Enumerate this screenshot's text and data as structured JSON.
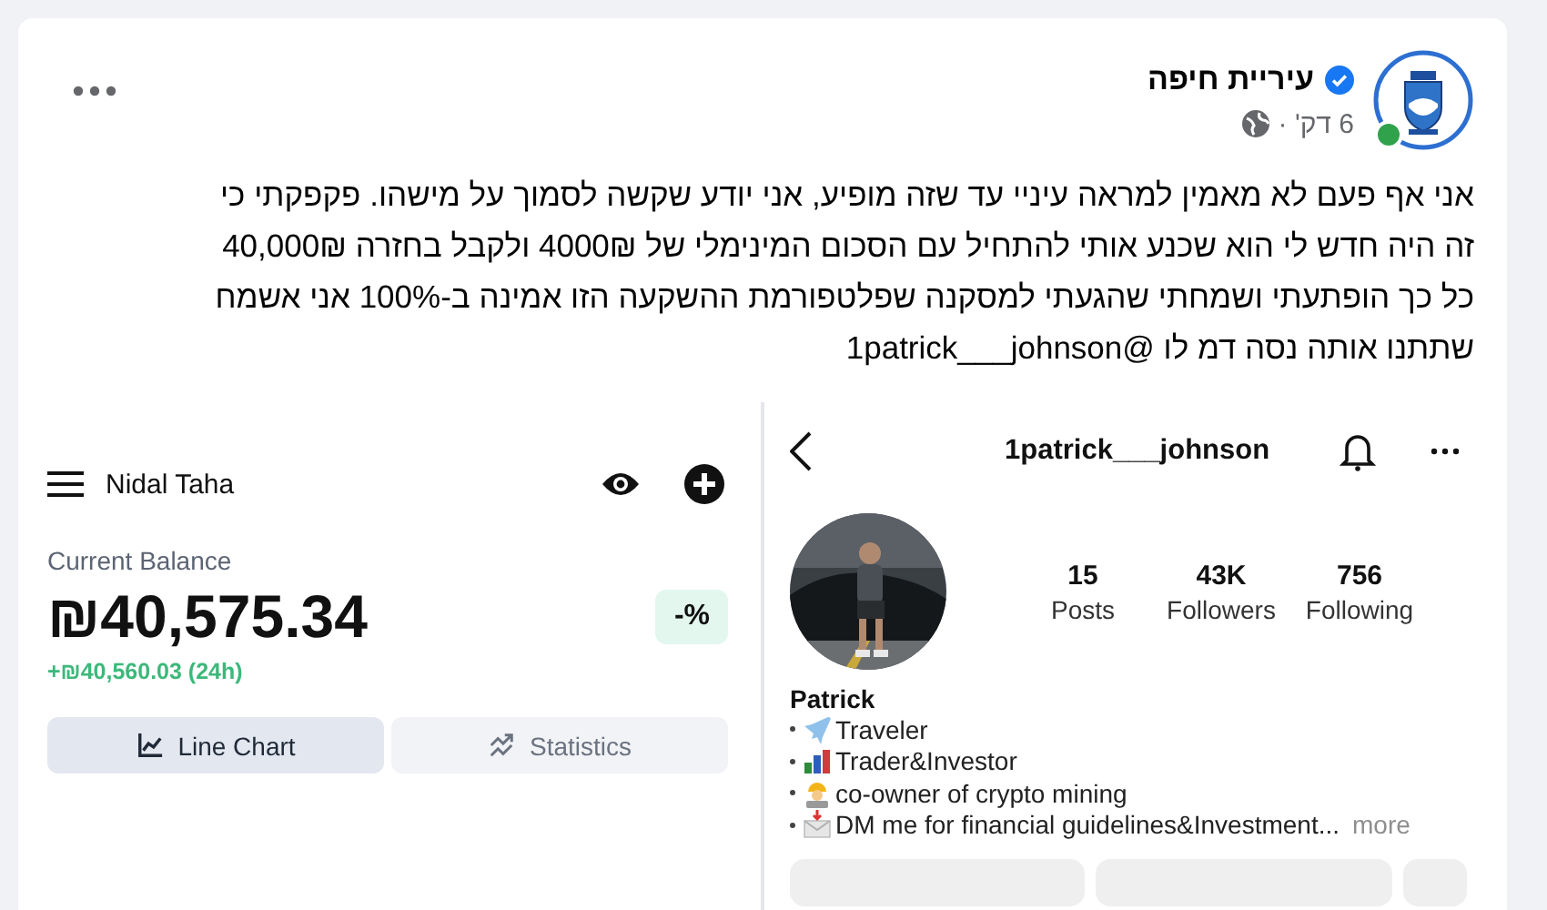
{
  "post": {
    "author": "עיריית חיפה",
    "verified": true,
    "online": true,
    "time": "6 דק' ·",
    "lines": [
      "אני אף פעם לא מאמין למראה עיניי עד שזה מופיע, אני יודע שקשה לסמוך על מישהו.  פקפקתי כי",
      "זה היה חדש לי הוא שכנע אותי להתחיל עם הסכום המינימלי של 4000₪ ולקבל בחזרה 40,000₪",
      "כל כך הופתעתי ושמחתי שהגעתי למסקנה שפלטפורמת ההשקעה הזו אמינה ב-100% אני אשמח",
      "שתתנו אותה  נסה דמ לו @1patrick___johnson"
    ]
  },
  "wallet": {
    "user": "Nidal Taha",
    "balance_label": "Current Balance",
    "balance": "₪40,575.34",
    "change_badge": "-%",
    "change": "+₪40,560.03 (24h)",
    "tabs": [
      {
        "label": "Line Chart",
        "selected": true
      },
      {
        "label": "Statistics",
        "selected": false
      }
    ]
  },
  "profile": {
    "username": "1patrick___johnson",
    "stats": [
      {
        "value": "15",
        "label": "Posts"
      },
      {
        "value": "43K",
        "label": "Followers"
      },
      {
        "value": "756",
        "label": "Following"
      }
    ],
    "name": "Patrick",
    "bio": [
      {
        "kind": "plane",
        "text": "Traveler"
      },
      {
        "kind": "chart",
        "text": "Trader&Investor"
      },
      {
        "kind": "worker",
        "text": "co-owner of crypto mining"
      },
      {
        "kind": "mail",
        "text": "DM me for financial guidelines&Investment...",
        "more": "more"
      }
    ]
  }
}
